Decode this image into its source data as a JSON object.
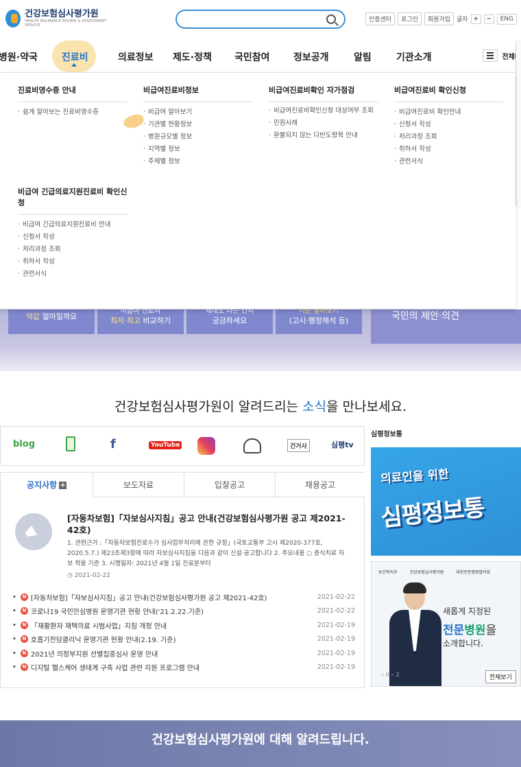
{
  "header": {
    "logo_text": "건강보험심사평가원",
    "logo_sub": "HEALTH INSURANCE REVIEW & ASSESSMENT SERVICE",
    "search_placeholder": "",
    "util": [
      "인증센터",
      "로그인",
      "회원가입"
    ],
    "font_label": "글자",
    "font_plus": "+",
    "font_minus": "−",
    "lang": "ENG"
  },
  "gnb": {
    "items": [
      "병원·약국",
      "진료비",
      "의료정보",
      "제도·정책",
      "국민참여",
      "정보공개",
      "알림",
      "기관소개"
    ],
    "active": "진료비",
    "all_menu": "전체메"
  },
  "mega": {
    "columns": [
      {
        "title": "진료비영수증 안내",
        "items": [
          "쉽게 알아보는 진료비영수증"
        ]
      },
      {
        "title": "비급여진료비정보",
        "items": [
          "비급여 알아보기",
          "기관별 현황정보",
          "병원규모별 정보",
          "지역별 정보",
          "주제별 정보"
        ]
      },
      {
        "title": "비급여진료비확인 자가점검",
        "items": [
          "비급여진료비확인신청 대상여부 조회",
          "민원사례",
          "환불되지 않는 다빈도항목 안내"
        ]
      },
      {
        "title": "비급여진료비 확인신청",
        "items": [
          "비급여진료비 확인안내",
          "신청서 작성",
          "처리과정 조회",
          "취하서 작성",
          "관련서식"
        ]
      },
      {
        "title": "비급여 긴급의료지원진료비 확인신청",
        "items": [
          "비급여 긴급의료지원진료비 안내",
          "신청서 작성",
          "처리과정 조회",
          "취하서 작성",
          "관련서식"
        ]
      }
    ]
  },
  "quick": {
    "q1_hl": "약값",
    "q1": "얼마일까요",
    "q2_top": "비급여 진료비",
    "q2_hl": "최저·최고",
    "q2": "비교하기",
    "q3_top": "제네도 나는 건지",
    "q3": "궁금하세요",
    "q4_top": "기준 알아보기",
    "q4": "(고시·행정해석 등)",
    "right": "국민의 제안·의견"
  },
  "news_section": {
    "heading_pre": "건강보험심사평가원이 알려드리는 ",
    "heading_hl": "소식",
    "heading_post": "을 만나보세요."
  },
  "sns": [
    "blog",
    "f",
    "YouTube",
    "건거사",
    "심평tv"
  ],
  "tabs": {
    "labels": [
      "공지사항",
      "보도자료",
      "입찰공고",
      "채용공고"
    ],
    "plus": "+",
    "featured": {
      "title": "[자동차보험]「자보심사지침」공고 안내(건강보험심사평가원 공고 제2021-42호)",
      "body": "1. 관련근거 :「자동차보험진료수가 심사업무처리에 관한 규정」(국토교통부 고시 제2020-377호, 2020.5.7.) 제23조제3항에 따라 자보심사지침을 다음과 같이 신설·공고합니다 2. 주요내용 ○ 증식치료 자보 적용 기준 3. 시행일자: 2021년 4월 1일 진료분부터",
      "date": "2021-02-22"
    },
    "list": [
      {
        "text": "[자동차보험]「자보심사지침」공고 안내(건강보험심사평가원 공고 제2021-42호)",
        "date": "2021-02-22"
      },
      {
        "text": "코로나19 국민안심병원 운영기관 현황 안내('21.2.22.기준)",
        "date": "2021-02-22"
      },
      {
        "text": "「재활환자 재택의료 시범사업」지침 개정 안내",
        "date": "2021-02-19"
      },
      {
        "text": "호흡기전담클리닉 운영기관 현황 안내(2.19. 기준)",
        "date": "2021-02-19"
      },
      {
        "text": "2021년 의정부지원 선별집중심사 운영 안내",
        "date": "2021-02-19"
      },
      {
        "text": "디지털 헬스케어 생태계 구축 사업 관련 지원 프로그램 안내",
        "date": "2021-02-19"
      }
    ],
    "new_badge": "N"
  },
  "sidebar": {
    "title": "심평정보통",
    "banner1_small": "의료인을 위한",
    "banner1_big": "심평정보통",
    "banner2_logos": [
      "보건복지부",
      "건강보험심사평가원",
      "대한전문병원협의회"
    ],
    "banner2_t1": "새롭게 지정된",
    "banner2_t2a": "전문",
    "banner2_t2b": "병원",
    "banner2_t2c": "을",
    "banner2_t3": "소개합니다.",
    "banner2_ctrl": "‹ II ›  2",
    "banner2_all": "전체보기"
  },
  "footer": {
    "text": "건강보험심사평가원에 대해 알려드립니다."
  },
  "colors": {
    "accent": "#2a71c9",
    "badge": "#e84c3d",
    "highlight": "#f9dfa0"
  }
}
